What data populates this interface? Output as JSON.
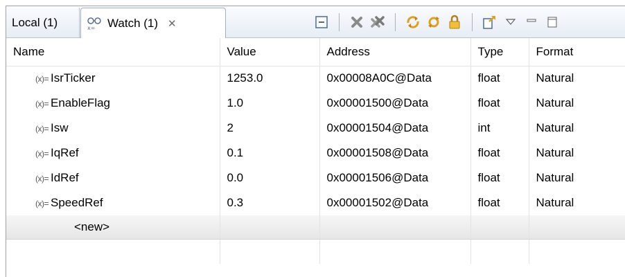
{
  "tabs": {
    "local": "Local (1)",
    "watch": "Watch (1)",
    "close_glyph": "✕"
  },
  "toolbar": {
    "icons": [
      "collapse-all-icon",
      "remove-icon",
      "remove-all-icon",
      "refresh-icon",
      "continuous-refresh-icon",
      "lock-icon",
      "export-icon",
      "view-menu-icon",
      "minimize-icon",
      "maximize-icon"
    ]
  },
  "table": {
    "columns": [
      "Name",
      "Value",
      "Address",
      "Type",
      "Format"
    ],
    "var_icon": "(x)=",
    "rows": [
      {
        "name": "IsrTicker",
        "value": "1253.0",
        "address": "0x00008A0C@Data",
        "type": "float",
        "format": "Natural"
      },
      {
        "name": "EnableFlag",
        "value": "1.0",
        "address": "0x00001500@Data",
        "type": "float",
        "format": "Natural"
      },
      {
        "name": "Isw",
        "value": "2",
        "address": "0x00001504@Data",
        "type": "int",
        "format": "Natural"
      },
      {
        "name": "IqRef",
        "value": "0.1",
        "address": "0x00001508@Data",
        "type": "float",
        "format": "Natural"
      },
      {
        "name": "IdRef",
        "value": "0.0",
        "address": "0x00001506@Data",
        "type": "float",
        "format": "Natural"
      },
      {
        "name": "SpeedRef",
        "value": "0.3",
        "address": "0x00001502@Data",
        "type": "float",
        "format": "Natural"
      }
    ],
    "new_row_label": "<new>"
  }
}
